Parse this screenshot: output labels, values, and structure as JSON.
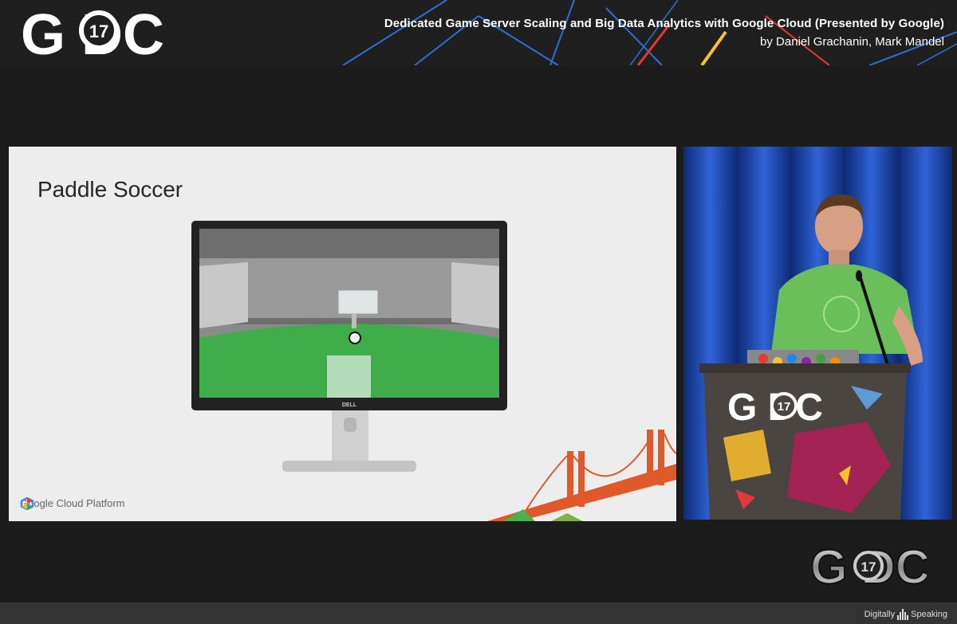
{
  "header": {
    "logo": {
      "text": "G DC",
      "year": "17"
    },
    "talk_title": "Dedicated Game Server Scaling and Big Data Analytics with Google Cloud (Presented by Google)",
    "talk_authors": "by Daniel Grachanin, Mark Mandel"
  },
  "slide": {
    "title": "Paddle Soccer",
    "monitor_brand": "DELL",
    "footer_brand": "Google Cloud Platform"
  },
  "video": {
    "podium_logo": {
      "text": "G DC",
      "year": "17"
    }
  },
  "watermark": {
    "logo": {
      "text": "G DC",
      "year": "17"
    }
  },
  "footer": {
    "brand_left": "Digitally",
    "brand_right": "Speaking"
  },
  "colors": {
    "header_bg": "#1f1f1f",
    "accent_blue": "#1e88e5",
    "accent_red": "#e53935",
    "accent_yellow": "#fbc02d",
    "field_green": "#3fae4a",
    "shirt_green": "#6bbf5a",
    "curtain_blue": "#1f4fbf"
  }
}
